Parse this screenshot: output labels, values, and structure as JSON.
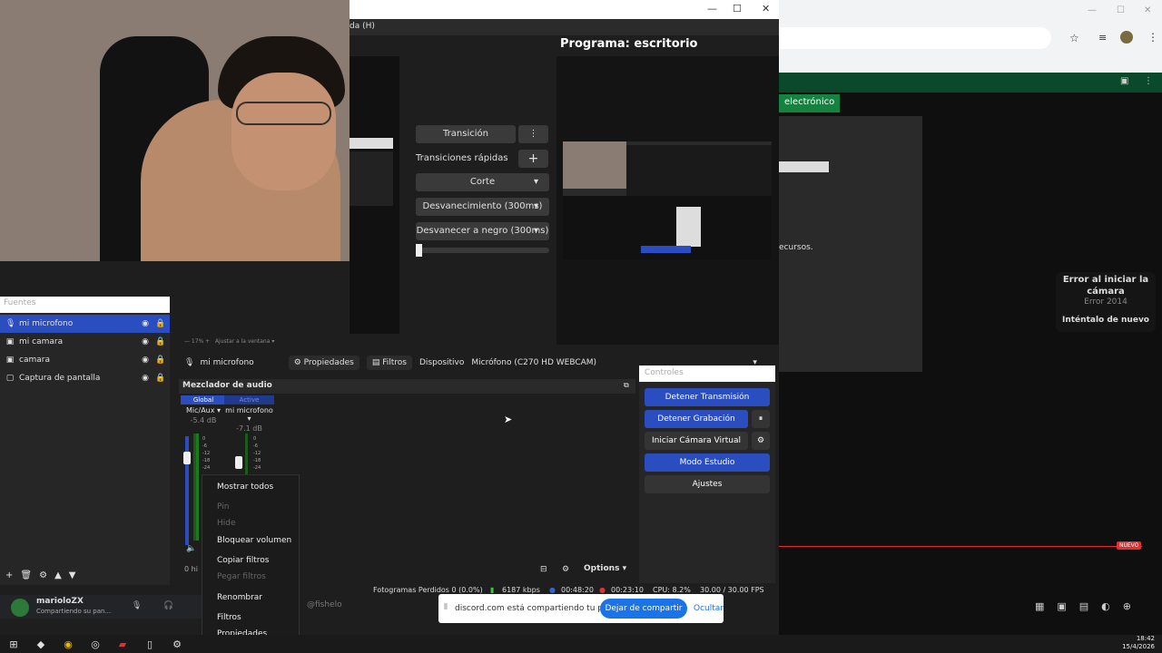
{
  "browser": {
    "tab_tag": "electrónico",
    "error_title": "Error al iniciar la cámara",
    "error_code": "Error 2014",
    "error_button": "Inténtalo de nuevo",
    "nuevo_badge": "NUEVO",
    "recursos_text": "ecursos."
  },
  "obs": {
    "menu_partial": "da (H)",
    "program_title": "Programa: escritorio",
    "transition_button": "Transición",
    "quick_transitions_label": "Transiciones rápidas",
    "transitions": [
      "Corte",
      "Desvanecimiento (300ms)",
      "Desvanecer a negro (300ms)"
    ],
    "zoom_label": "17%",
    "fit_label": "Ajustar a la ventana",
    "sources_header": "Fuentes",
    "sources": [
      {
        "label": "mi microfono",
        "selected": true,
        "icon": "mic-icon"
      },
      {
        "label": "mi camara",
        "selected": false,
        "icon": "camera-icon"
      },
      {
        "label": "camara",
        "selected": false,
        "icon": "camera-icon"
      },
      {
        "label": "Captura de pantalla",
        "selected": false,
        "icon": "monitor-icon"
      }
    ],
    "props_bar": {
      "source_name": "mi microfono",
      "properties_label": "Propiedades",
      "filters_label": "Filtros",
      "device_label": "Dispositivo",
      "device_value": "Micrófono (C270 HD WEBCAM)"
    },
    "mixer": {
      "title": "Mezclador de audio",
      "tracks": [
        {
          "tab": "Global",
          "name": "Mic/Aux",
          "db": "-5.4 dB",
          "volume_fraction": 0.75
        },
        {
          "tab": "Active",
          "name": "mi microfono",
          "db": "-7.1 dB",
          "volume_fraction": 0.7
        }
      ],
      "scale": [
        "0",
        "-6",
        "-12",
        "-18",
        "-24"
      ],
      "hidden_text": "0 hi",
      "options_label": "Options"
    },
    "controls": {
      "header": "Controles",
      "stop_stream": "Detener Transmisión",
      "stop_record": "Detener Grabación",
      "virtual_cam": "Iniciar Cámara Virtual",
      "studio_mode": "Modo Estudio",
      "settings": "Ajustes"
    },
    "status": {
      "dropped": "Fotogramas Perdidos 0 (0.0%)",
      "bitrate": "6187 kbps",
      "stream_time": "00:48:20",
      "rec_time": "00:23:10",
      "cpu": "CPU: 8.2%",
      "fps": "30.00 / 30.00 FPS"
    }
  },
  "context_menu": {
    "items": [
      {
        "label": "Mostrar todos",
        "disabled": false
      },
      {
        "label": "Pin",
        "disabled": true
      },
      {
        "label": "Hide",
        "disabled": true
      },
      {
        "label": "Bloquear volumen",
        "disabled": false
      },
      {
        "label": "Copiar filtros",
        "disabled": false
      },
      {
        "label": "Pegar filtros",
        "disabled": true
      },
      {
        "label": "Renombrar",
        "disabled": false
      },
      {
        "label": "Filtros",
        "disabled": false
      },
      {
        "label": "Propiedades",
        "disabled": false
      }
    ]
  },
  "discord": {
    "username": "marioloZX",
    "status": "Compartiendo su pan...",
    "mention": "@fishelo"
  },
  "share_banner": {
    "message": "discord.com está compartiendo tu pantalla.",
    "stop_button": "Dejar de compartir",
    "hide_button": "Ocultar"
  },
  "taskbar": {
    "time": "18:42",
    "date": "15/4/2026"
  },
  "colors": {
    "accent_blue": "#2a4dbf",
    "chrome_blue": "#1a73e8",
    "tag_green": "#13833f",
    "record_red": "#e03030"
  }
}
